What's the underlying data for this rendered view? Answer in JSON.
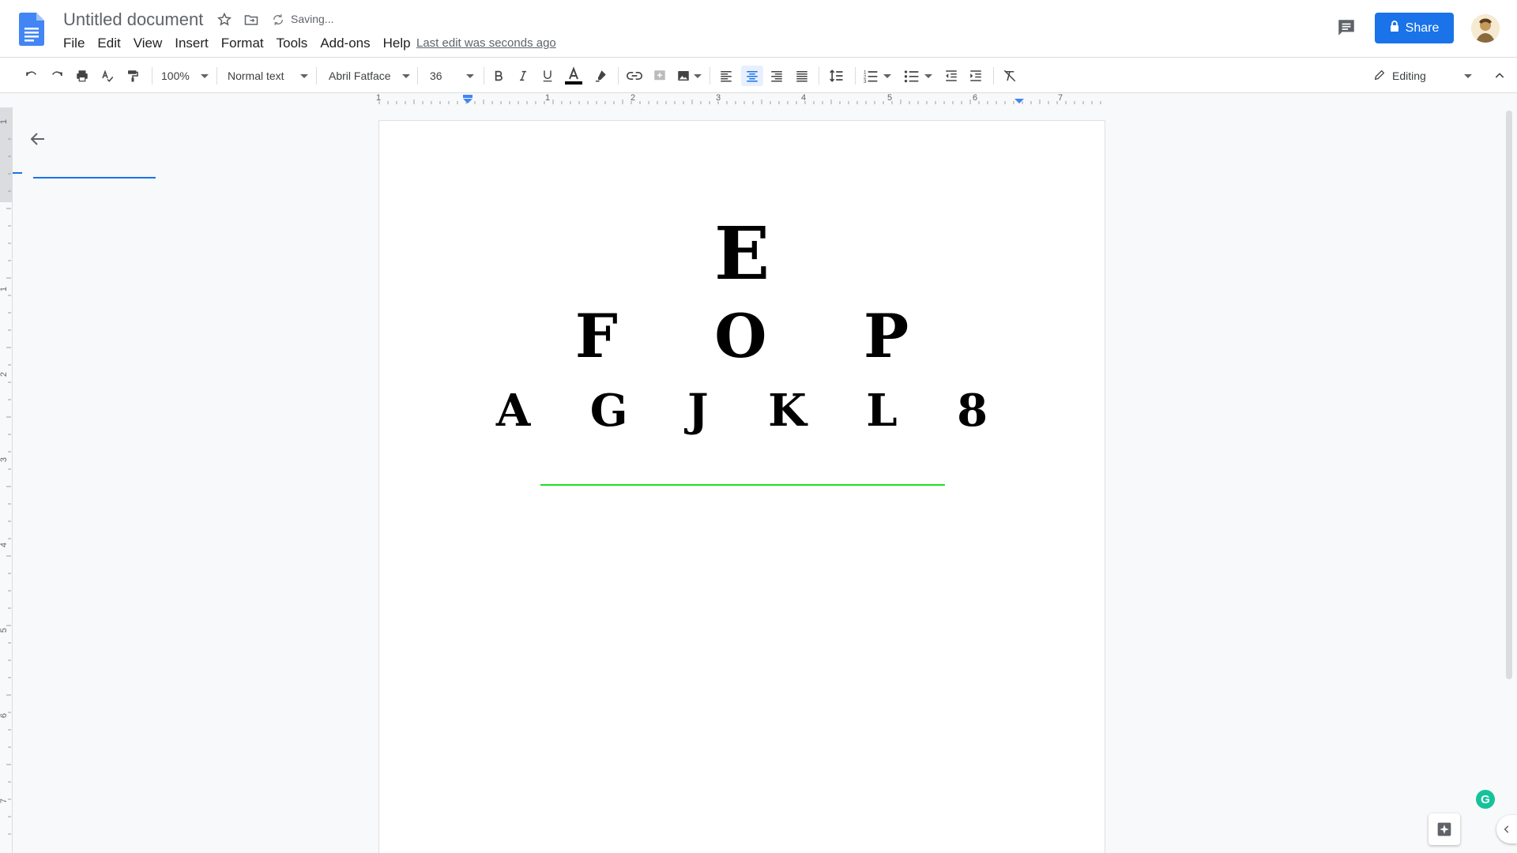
{
  "header": {
    "title": "Untitled document",
    "status": "Saving...",
    "last_edit": "Last edit was seconds ago",
    "share_label": "Share"
  },
  "menu": [
    "File",
    "Edit",
    "View",
    "Insert",
    "Format",
    "Tools",
    "Add-ons",
    "Help"
  ],
  "toolbar": {
    "zoom": "100%",
    "style": "Normal text",
    "font": "Abril Fatface",
    "size": "36",
    "mode": "Editing"
  },
  "ruler": {
    "horizontal": [
      "1",
      "1",
      "2",
      "3",
      "4",
      "5",
      "6",
      "7"
    ],
    "vertical": [
      "1",
      "1",
      "2",
      "3",
      "4",
      "5",
      "6",
      "7"
    ]
  },
  "document": {
    "lines": [
      "E",
      "F O P",
      "A G J K L 8"
    ]
  },
  "colors": {
    "accent": "#1a73e8",
    "green_line": "#22dd22",
    "grammarly": "#15c39a"
  },
  "grammarly_label": "G",
  "icons": [
    "docs-logo-icon",
    "star-icon",
    "move-folder-icon",
    "sync-icon",
    "comment-icon",
    "lock-icon",
    "undo-icon",
    "redo-icon",
    "print-icon",
    "spellcheck-icon",
    "paint-format-icon",
    "bold-icon",
    "italic-icon",
    "underline-icon",
    "text-color-icon",
    "highlight-icon",
    "link-icon",
    "insert-comment-icon",
    "insert-image-icon",
    "align-left-icon",
    "align-center-icon",
    "align-right-icon",
    "align-justify-icon",
    "line-spacing-icon",
    "numbered-list-icon",
    "bulleted-list-icon",
    "decrease-indent-icon",
    "increase-indent-icon",
    "clear-formatting-icon",
    "pencil-icon",
    "collapse-icon",
    "back-arrow-icon",
    "explore-icon"
  ]
}
